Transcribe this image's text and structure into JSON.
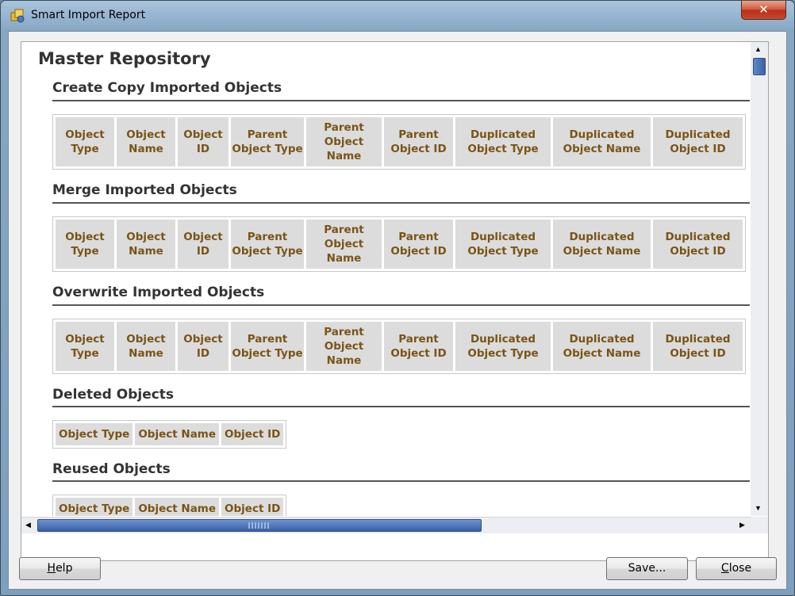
{
  "window": {
    "title": "Smart Import Report",
    "close_glyph": "✕"
  },
  "report": {
    "title": "Master Repository",
    "sections": [
      {
        "title": "Create Copy Imported Objects",
        "columns": [
          "Object Type",
          "Object Name",
          "Object ID",
          "Parent Object Type",
          "Parent Object Name",
          "Parent Object ID",
          "Duplicated Object Type",
          "Duplicated Object Name",
          "Duplicated Object ID"
        ]
      },
      {
        "title": "Merge Imported Objects",
        "columns": [
          "Object Type",
          "Object Name",
          "Object ID",
          "Parent Object Type",
          "Parent Object Name",
          "Parent Object ID",
          "Duplicated Object Type",
          "Duplicated Object Name",
          "Duplicated Object ID"
        ]
      },
      {
        "title": "Overwrite Imported Objects",
        "columns": [
          "Object Type",
          "Object Name",
          "Object ID",
          "Parent Object Type",
          "Parent Object Name",
          "Parent Object ID",
          "Duplicated Object Type",
          "Duplicated Object Name",
          "Duplicated Object ID"
        ]
      },
      {
        "title": "Deleted Objects",
        "columns": [
          "Object Type",
          "Object Name",
          "Object ID"
        ]
      },
      {
        "title": "Reused Objects",
        "columns": [
          "Object Type",
          "Object Name",
          "Object ID"
        ]
      }
    ]
  },
  "buttons": {
    "help": {
      "label": "Help",
      "mnemonic": "H",
      "rest": "elp"
    },
    "save": {
      "label": "Save..."
    },
    "close": {
      "label": "Close",
      "mnemonic": "C",
      "rest": "lose"
    }
  },
  "scrollbar_arrows": {
    "up": "▲",
    "down": "▼",
    "left": "◀",
    "right": "▶"
  }
}
